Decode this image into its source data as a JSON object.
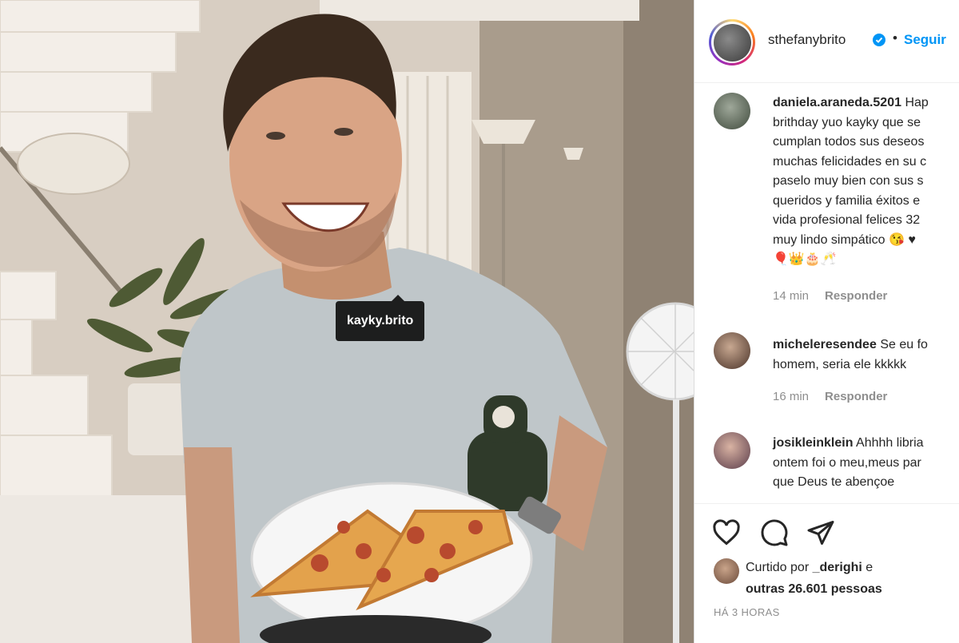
{
  "photo": {
    "tag_label": "kayky.brito",
    "alt": ""
  },
  "header": {
    "username": "sthefanybrito",
    "separator": "•",
    "follow_label": "Seguir"
  },
  "comments": [
    {
      "username": "daniela.araneda.5201",
      "lines": [
        "Hap",
        "brithday yuo kayky que se",
        "cumplan todos sus deseos",
        "muchas felicidades en su c",
        "paselo muy bien con sus s",
        "queridos y familia éxitos e",
        "vida profesional felices 32",
        "muy lindo simpático 😘 ♥",
        "🎈👑🎂🥂"
      ],
      "time": "14 min",
      "reply_label": "Responder"
    },
    {
      "username": "micheleresendee",
      "lines": [
        "Se eu fo",
        "homem, seria ele kkkkk"
      ],
      "time": "16 min",
      "reply_label": "Responder"
    },
    {
      "username": "josikleinklein",
      "lines": [
        "Ahhhh libria",
        "ontem foi o meu,meus par",
        "que Deus te abençoe"
      ],
      "time": "",
      "reply_label": ""
    }
  ],
  "actions": {
    "like_icon": "heart-icon",
    "comment_icon": "comment-icon",
    "share_icon": "paper-plane-icon"
  },
  "likes": {
    "prefix": "Curtido por",
    "user": "_derighi",
    "conj": "e",
    "others": "outras 26.601 pessoas"
  },
  "timestamp": "HÁ 3 HORAS",
  "colors": {
    "accent": "#0095f6",
    "muted": "#8e8e8e",
    "text": "#262626",
    "tag_bg": "#000000"
  }
}
